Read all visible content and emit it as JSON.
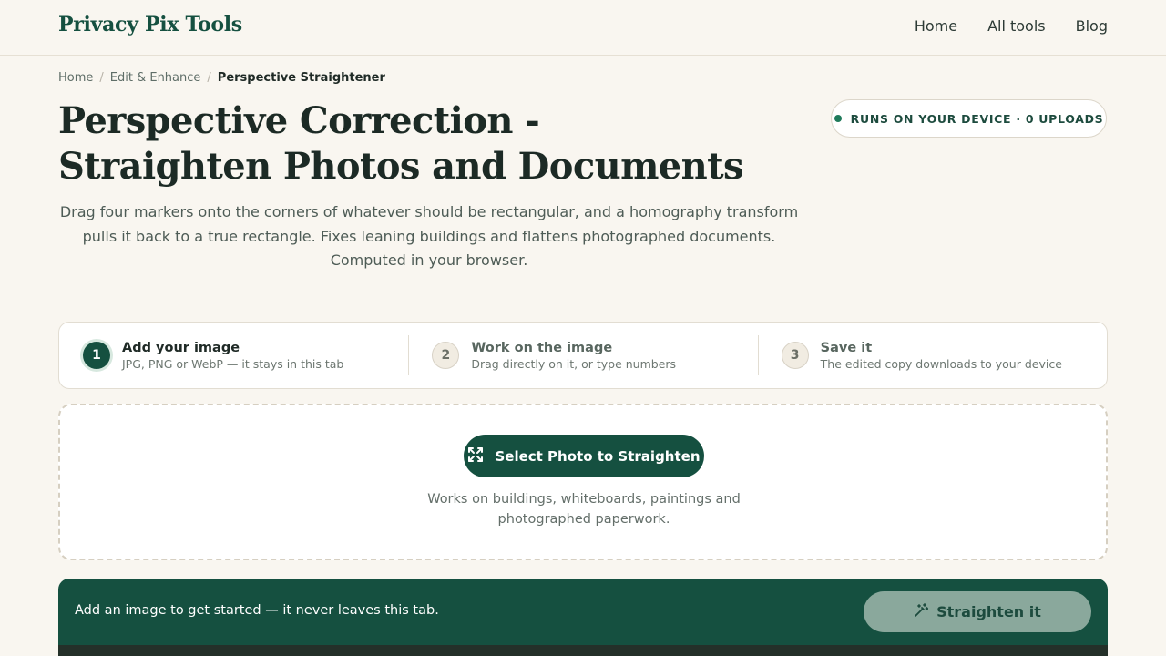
{
  "header": {
    "logo": "Privacy Pix Tools",
    "nav": [
      "Home",
      "All tools",
      "Blog"
    ]
  },
  "breadcrumb": {
    "items": [
      "Home",
      "Edit & Enhance"
    ],
    "separator": "/",
    "current": "Perspective Straightener"
  },
  "hero": {
    "title": "Perspective Correction - Straighten Photos and Documents",
    "subtitle": "Drag four markers onto the corners of whatever should be rectangular, and a homography transform pulls it back to a true rectangle. Fixes leaning buildings and flattens photographed documents. Computed in your browser.",
    "badge": "RUNS ON YOUR DEVICE · 0 UPLOADS"
  },
  "steps": [
    {
      "number": "1",
      "title": "Add your image",
      "desc": "JPG, PNG or WebP — it stays in this tab",
      "active": true
    },
    {
      "number": "2",
      "title": "Work on the image",
      "desc": "Drag directly on it, or type numbers",
      "active": false
    },
    {
      "number": "3",
      "title": "Save it",
      "desc": "The edited copy downloads to your device",
      "active": false
    }
  ],
  "dropzone": {
    "button_label": "Select Photo to Straighten",
    "button_icon": "expand-arrows-icon",
    "hint": "Works on buildings, whiteboards, paintings and photographed paperwork."
  },
  "actionbar": {
    "message": "Add an image to get started — it never leaves this tab.",
    "button_label": "Straighten it",
    "button_icon": "magic-wand-icon"
  },
  "colors": {
    "brand": "#155040",
    "background": "#f9f6f0",
    "disabled_button": "#8aa89c"
  }
}
